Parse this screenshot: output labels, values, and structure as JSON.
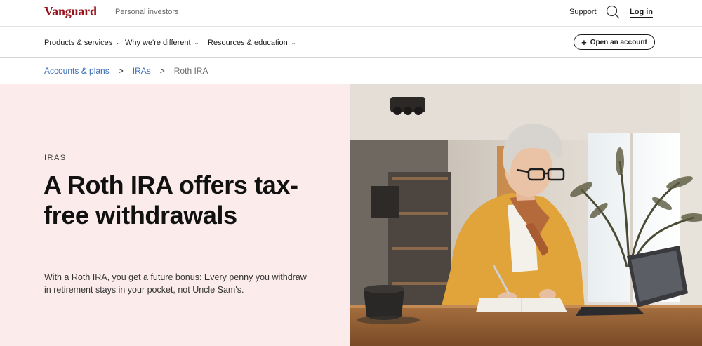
{
  "header": {
    "brand": "Vanguard",
    "segment": "Personal investors",
    "support_label": "Support",
    "search_icon": "search-icon",
    "login_label": "Log in"
  },
  "nav": {
    "items": [
      {
        "label": "Products & services"
      },
      {
        "label": "Why we're different"
      },
      {
        "label": "Resources & education"
      }
    ],
    "open_account_label": "Open an account"
  },
  "breadcrumb": {
    "items": [
      {
        "label": "Accounts & plans"
      },
      {
        "label": "IRAs"
      }
    ],
    "current": "Roth IRA",
    "separator": ">"
  },
  "hero": {
    "eyebrow": "IRAS",
    "headline": "A Roth IRA offers tax-free withdrawals",
    "subtext": "With a Roth IRA, you get a future bonus: Every penny you withdraw in retirement stays in your pocket, not Uncle Sam's.",
    "background_color": "#fbeceb"
  },
  "colors": {
    "brand": "#96151d",
    "link": "#3a6fb8"
  }
}
